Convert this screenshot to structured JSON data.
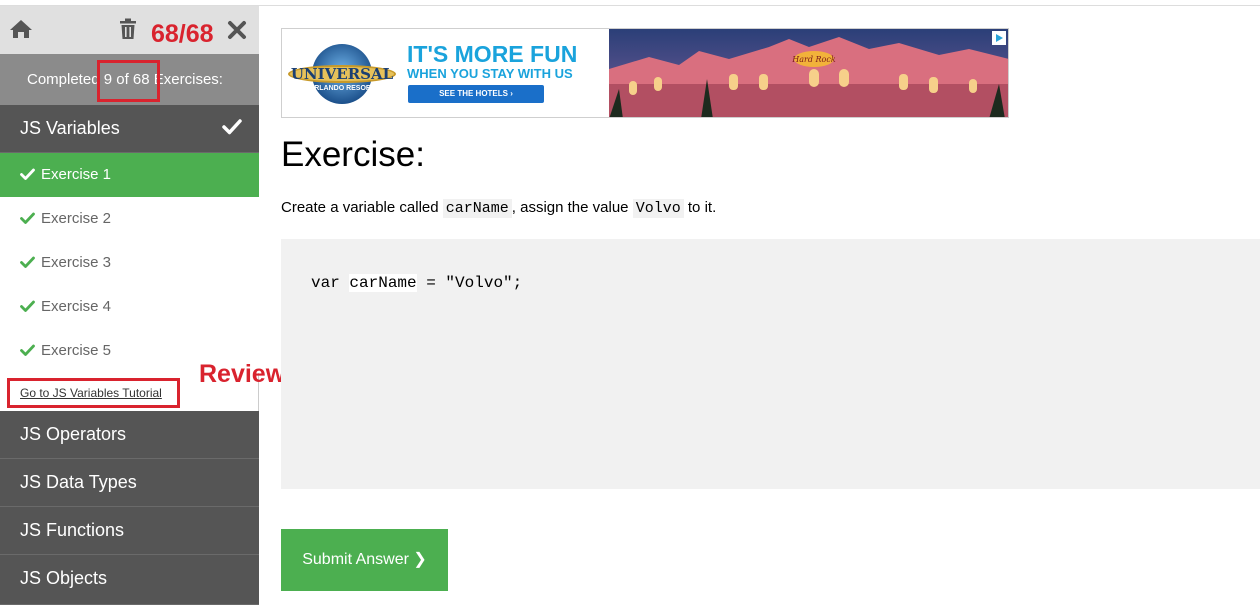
{
  "sidebar": {
    "score": "68/68",
    "progress_label_before": "Completed",
    "progress_count": "9 of 68",
    "progress_label_after": "Exercises:",
    "topics": [
      {
        "label": "JS Variables",
        "completed": true
      },
      {
        "label": "JS Operators"
      },
      {
        "label": "JS Data Types"
      },
      {
        "label": "JS Functions"
      },
      {
        "label": "JS Objects"
      }
    ],
    "exercises": [
      {
        "label": "Exercise 1",
        "active": true
      },
      {
        "label": "Exercise 2"
      },
      {
        "label": "Exercise 3"
      },
      {
        "label": "Exercise 4"
      },
      {
        "label": "Exercise 5"
      }
    ],
    "tutorial_link": "Go to JS Variables Tutorial"
  },
  "annotation": {
    "text": "Review the tutorial of each topic",
    "color": "#d9232e"
  },
  "ad": {
    "logo_text_1": "UNIVERSAL",
    "logo_text_2": "ORLANDO RESORT",
    "headline": "IT'S MORE FUN",
    "subline": "WHEN YOU STAY WITH US",
    "button": "SEE THE HOTELS ›",
    "sign_text": "Hard Rock"
  },
  "exercise": {
    "title": "Exercise:",
    "instruction_before": "Create a variable called",
    "instruction_var": "carName",
    "instruction_mid": ", assign the value",
    "instruction_value": "Volvo",
    "instruction_after": "to it.",
    "code_before": "var ",
    "code_var": "carName",
    "code_after": " = \"Volvo\";",
    "submit_label": "Submit Answer ❯"
  },
  "colors": {
    "accent_green": "#4caf50",
    "sidebar_dark": "#555555",
    "annotation_red": "#d9232e"
  }
}
